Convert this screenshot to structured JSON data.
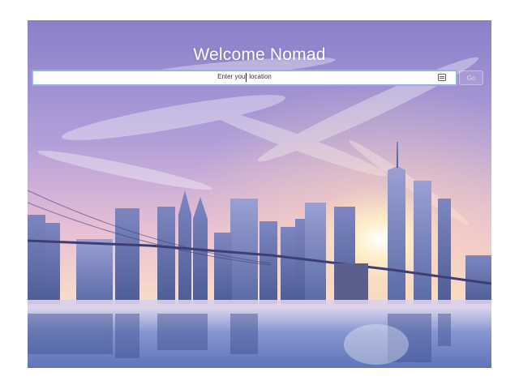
{
  "page": {
    "title": "Welcome Nomad"
  },
  "search": {
    "placeholder": "Enter your location",
    "icon": "address-card-icon"
  },
  "go_button": {
    "label": "Go"
  },
  "colors": {
    "input_border": "#8fb3ea",
    "sky_top": "#8a7fc9",
    "sky_glow": "#fff1c8",
    "water": "#6f86c4"
  }
}
